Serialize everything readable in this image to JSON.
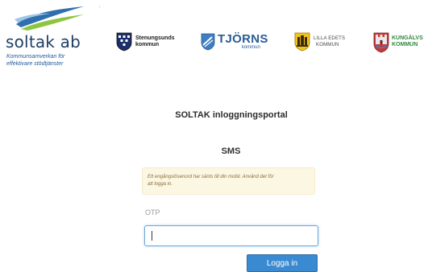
{
  "header": {
    "brand": {
      "name": "soltak ab",
      "tagline_line1": "Kommunsamverkan för",
      "tagline_line2": "effektivare stödtjänster",
      "colors": {
        "wave_blue": "#2f6fae",
        "wave_green": "#8cc63f",
        "text": "#1f3f66"
      }
    },
    "partners": [
      {
        "icon": "stenungsund-coat-of-arms-icon",
        "line1": "Stenungsunds",
        "line2": "kommun"
      },
      {
        "icon": "tjorn-coat-of-arms-icon",
        "line1": "TJÖRNS",
        "line2": "kommun"
      },
      {
        "icon": "lilla-edet-coat-of-arms-icon",
        "line1": "LILLA EDETS",
        "line2": "KOMMUN"
      },
      {
        "icon": "kungalv-coat-of-arms-icon",
        "line1": "KUNGÄLVS",
        "line2": "KOMMUN"
      }
    ]
  },
  "portal": {
    "title": "SOLTAK inloggningsportal"
  },
  "sms": {
    "heading": "SMS",
    "alert_line1": "Ett engångslösenord har sänts till din mobil. Använd det för",
    "alert_line2": "att logga in.",
    "otp_label": "OTP",
    "otp_value": "",
    "login_label": "Logga in",
    "colors": {
      "alert_bg": "#fcf7e3",
      "alert_text": "#8a6d3b",
      "button_bg": "#3a8ad1"
    }
  }
}
